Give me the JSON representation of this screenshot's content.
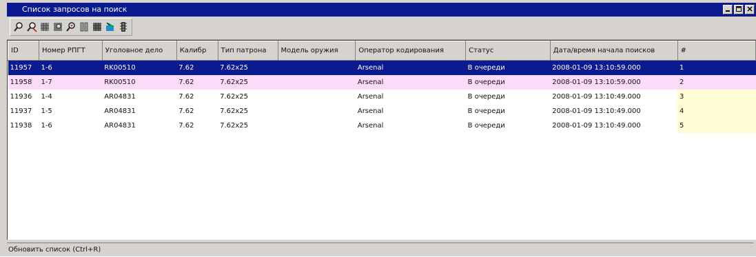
{
  "window": {
    "title": "Список запросов на поиск",
    "controls": [
      "minimize",
      "maximize",
      "close"
    ]
  },
  "toolbar": {
    "buttons": [
      {
        "icon": "search-icon"
      },
      {
        "icon": "search-edit-icon"
      },
      {
        "icon": "grid-icon"
      },
      {
        "icon": "grid-search-icon"
      },
      {
        "icon": "search-person-icon"
      },
      {
        "icon": "columns-icon"
      },
      {
        "icon": "grid-dark-icon"
      },
      {
        "icon": "export-icon"
      },
      {
        "icon": "traffic-light-icon"
      }
    ]
  },
  "table": {
    "columns": [
      "ID",
      "Номер РПГТ",
      "Уголовное дело",
      "Калибр",
      "Тип патрона",
      "Модель оружия",
      "Оператор кодирования",
      "Статус",
      "Дата/время начала поисков",
      "#"
    ],
    "rows": [
      [
        "11957",
        "1-6",
        "RK00510",
        "7.62",
        "7.62x25",
        "",
        "Arsenal",
        "В очереди",
        "2008-01-09 13:10:59.000",
        "1"
      ],
      [
        "11958",
        "1-7",
        "RK00510",
        "7.62",
        "7.62x25",
        "",
        "Arsenal",
        "В очереди",
        "2008-01-09 13:10:59.000",
        "2"
      ],
      [
        "11936",
        "1-4",
        "AR04831",
        "7.62",
        "7.62x25",
        "",
        "Arsenal",
        "В очереди",
        "2008-01-09 13:10:49.000",
        "3"
      ],
      [
        "11937",
        "1-5",
        "AR04831",
        "7.62",
        "7.62x25",
        "",
        "Arsenal",
        "В очереди",
        "2008-01-09 13:10:49.000",
        "4"
      ],
      [
        "11938",
        "1-6",
        "AR04831",
        "7.62",
        "7.62x25",
        "",
        "Arsenal",
        "В очереди",
        "2008-01-09 13:10:49.000",
        "5"
      ]
    ]
  },
  "statusbar": {
    "text": "Обновить список (Ctrl+R)"
  },
  "colors": {
    "title_bar": "#0a1a8f",
    "selected_row": "#0a1a8f",
    "highlight_row": "#fbdcf8",
    "number_column": "#fffbd2"
  }
}
